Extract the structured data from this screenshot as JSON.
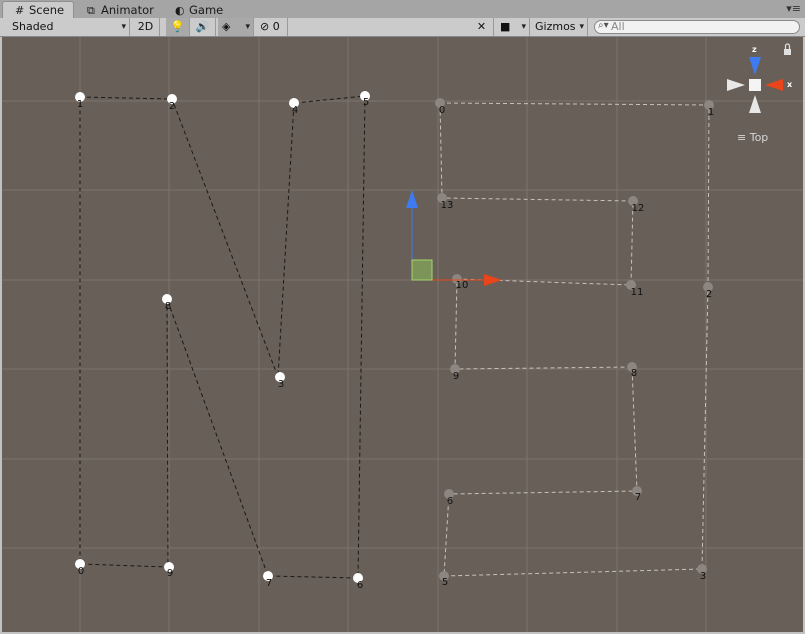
{
  "tabs": [
    {
      "label": "Scene",
      "icon": "grid-icon",
      "active": true
    },
    {
      "label": "Animator",
      "icon": "animator-icon",
      "active": false
    },
    {
      "label": "Game",
      "icon": "game-icon",
      "active": false
    }
  ],
  "toolbar": {
    "shading_mode": "Shaded",
    "mode_2d": "2D",
    "hidden_count": "0",
    "gizmos": "Gizmos",
    "search_placeholder": "All"
  },
  "gizmo": {
    "axis_z": "z",
    "axis_x": "x",
    "view": "Top"
  },
  "path_left": {
    "points": [
      {
        "label": "1"
      },
      {
        "label": "2"
      },
      {
        "label": "4"
      },
      {
        "label": "5"
      },
      {
        "label": "8"
      },
      {
        "label": "3"
      },
      {
        "label": "0"
      },
      {
        "label": "9"
      },
      {
        "label": "7"
      },
      {
        "label": "6"
      }
    ]
  },
  "path_right": {
    "points": [
      {
        "label": "0"
      },
      {
        "label": "1"
      },
      {
        "label": "13"
      },
      {
        "label": "12"
      },
      {
        "label": "10"
      },
      {
        "label": "11"
      },
      {
        "label": "2"
      },
      {
        "label": "9"
      },
      {
        "label": "8"
      },
      {
        "label": "6"
      },
      {
        "label": "7"
      },
      {
        "label": "5"
      },
      {
        "label": "3"
      }
    ]
  },
  "colors": {
    "scene_bg": "#675f58",
    "grid": "#7b736d",
    "handle_y": "#3f7bf0",
    "handle_x": "#e8451a",
    "handle_center": "#8fbf5a"
  }
}
